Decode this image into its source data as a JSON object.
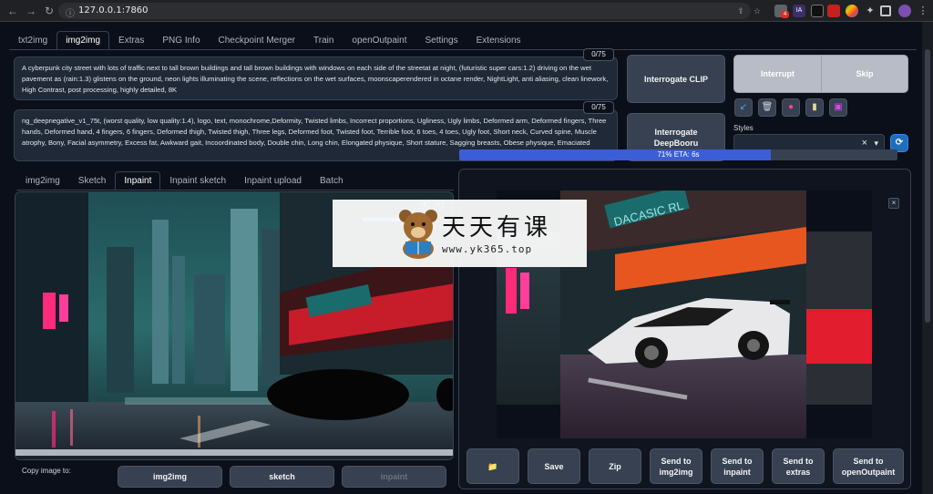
{
  "browser": {
    "url": "127.0.0.1:7860",
    "back_icon": "arrow-left-icon",
    "forward_icon": "arrow-right-icon",
    "reload_icon": "reload-icon",
    "extension_badge": "4"
  },
  "top_tabs": [
    {
      "label": "txt2img",
      "active": false
    },
    {
      "label": "img2img",
      "active": true
    },
    {
      "label": "Extras",
      "active": false
    },
    {
      "label": "PNG Info",
      "active": false
    },
    {
      "label": "Checkpoint Merger",
      "active": false
    },
    {
      "label": "Train",
      "active": false
    },
    {
      "label": "openOutpaint",
      "active": false
    },
    {
      "label": "Settings",
      "active": false
    },
    {
      "label": "Extensions",
      "active": false
    }
  ],
  "prompt": {
    "positive": "A cyberpunk city street with lots of traffic next to tall brown buildings and tall brown buildings with windows on each side of the streetat at night, (futuristic super cars:1.2) driving on the wet pavement as (rain:1.3) glistens on the ground, neon lights illuminating the scene, reflections on the wet surfaces, moonscaperendered in octane render, NightLight, anti aliasing, clean linework, High Contrast, post processing, highly detailed, 8K",
    "positive_counter": "0/75",
    "negative": "ng_deepnegative_v1_75t, (worst quality, low quality:1.4), logo, text, monochrome,Deformity, Twisted limbs, Incorrect proportions, Ugliness, Ugly limbs, Deformed arm, Deformed fingers, Three hands, Deformed hand, 4 fingers, 6 fingers, Deformed thigh, Twisted thigh, Three legs, Deformed foot, Twisted foot, Terrible foot, 6 toes, 4 toes, Ugly foot, Short neck, Curved spine, Muscle atrophy, Bony, Facial asymmetry, Excess fat, Awkward gait, Incoordinated body, Double chin, Long chin, Elongated physique, Short stature, Sagging breasts, Obese physique, Emaciated",
    "negative_counter": "0/75"
  },
  "actions": {
    "interrogate_clip": "Interrogate CLIP",
    "interrogate_deepbooru": "Interrogate DeepBooru",
    "interrupt": "Interrupt",
    "skip": "Skip",
    "styles_label": "Styles",
    "styles_clear": "×",
    "styles_dropdown": "▾"
  },
  "tools": [
    "arrow-icon",
    "trash-icon",
    "paint-icon",
    "clipboard-icon",
    "save-style-icon"
  ],
  "sub_tabs": [
    {
      "label": "img2img",
      "active": false
    },
    {
      "label": "Sketch",
      "active": false
    },
    {
      "label": "Inpaint",
      "active": true
    },
    {
      "label": "Inpaint sketch",
      "active": false
    },
    {
      "label": "Inpaint upload",
      "active": false
    },
    {
      "label": "Batch",
      "active": false
    }
  ],
  "copy_image": {
    "label": "Copy image to:",
    "buttons": [
      "img2img",
      "sketch",
      "inpaint"
    ]
  },
  "progress": {
    "text": "71% ETA: 6s",
    "fraction": 0.71
  },
  "output_buttons": [
    {
      "label": "📁",
      "icon": "folder-icon"
    },
    {
      "label": "Save"
    },
    {
      "label": "Zip"
    },
    {
      "label": "Send to img2img"
    },
    {
      "label": "Send to inpaint"
    },
    {
      "label": "Send to extras"
    },
    {
      "label": "Send to openOutpaint"
    }
  ],
  "image_labels": {
    "sign_text": "DACASIC RL"
  },
  "watermark": {
    "cn": "天天有课",
    "url": "www.yk365.top"
  },
  "colors": {
    "accent": "#3b5ed6",
    "bg": "#0b0f19",
    "panel": "#1f2937",
    "neon_pink": "#ff2a7a",
    "neon_red": "#e11d2e",
    "teal": "#1fb5b0"
  }
}
